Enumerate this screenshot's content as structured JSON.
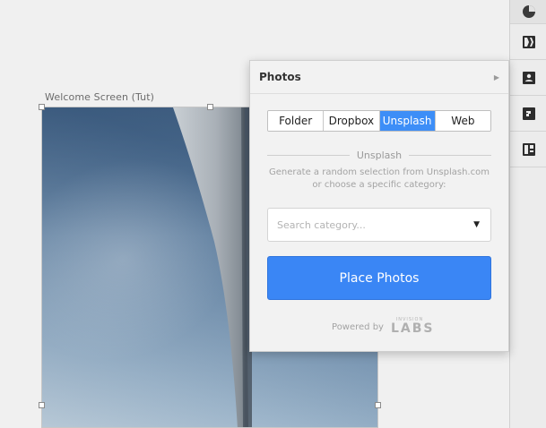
{
  "artboard": {
    "label": "Welcome Screen (Tut)"
  },
  "toolbar": {
    "icons": [
      "pie-chart-icon",
      "split-icon",
      "user-card-icon",
      "quote-icon",
      "layout-icon"
    ]
  },
  "photos_panel": {
    "title": "Photos",
    "tabs": [
      {
        "label": "Folder",
        "active": false
      },
      {
        "label": "Dropbox",
        "active": false
      },
      {
        "label": "Unsplash",
        "active": true
      },
      {
        "label": "Web",
        "active": false
      }
    ],
    "section_label": "Unsplash",
    "description": "Generate a random selection from Unsplash.com or choose a specific category:",
    "search_placeholder": "Search category...",
    "place_button_label": "Place Photos",
    "powered_by": "Powered by",
    "logo_small": "INVISION",
    "logo_big": "LABS"
  },
  "colors": {
    "accent": "#3a86f5",
    "tab_active": "#3d8ef7",
    "panel_bg": "#f2f2f2",
    "canvas_bg": "#f0f0f0"
  }
}
